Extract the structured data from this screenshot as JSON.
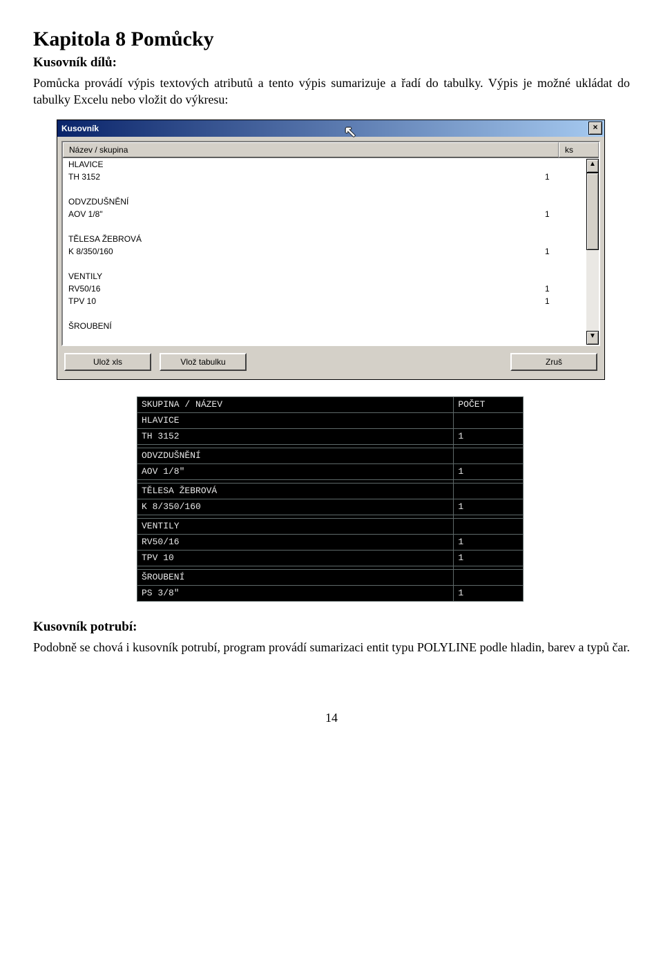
{
  "heading": "Kapitola 8   Pomůcky",
  "section1_title": "Kusovník dílů:",
  "section1_body": "Pomůcka provádí výpis textových atributů a tento výpis sumarizuje a řadí do tabulky. Výpis je možné ukládat do tabulky Excelu nebo vložit do výkresu:",
  "dialog": {
    "title": "Kusovník",
    "close": "×",
    "col_name": "Název / skupina",
    "col_ks": "ks",
    "rows": [
      {
        "name": "HLAVICE",
        "ks": ""
      },
      {
        "name": "TH 3152",
        "ks": "1"
      },
      {
        "name": "",
        "ks": ""
      },
      {
        "name": "ODVZDUŠNĚNÍ",
        "ks": ""
      },
      {
        "name": "AOV 1/8\"",
        "ks": "1"
      },
      {
        "name": "",
        "ks": ""
      },
      {
        "name": "TĚLESA ŽEBROVÁ",
        "ks": ""
      },
      {
        "name": "K 8/350/160",
        "ks": "1"
      },
      {
        "name": "",
        "ks": ""
      },
      {
        "name": "VENTILY",
        "ks": ""
      },
      {
        "name": "RV50/16",
        "ks": "1"
      },
      {
        "name": "TPV 10",
        "ks": "1"
      },
      {
        "name": "",
        "ks": ""
      },
      {
        "name": "ŠROUBENÍ",
        "ks": ""
      }
    ],
    "btn_save": "Ulož xls",
    "btn_insert": "Vlož tabulku",
    "btn_cancel": "Zruš"
  },
  "cad": {
    "hdr_name": "SKUPINA / NÁZEV",
    "hdr_count": "POČET",
    "rows": [
      {
        "name": "HLAVICE",
        "count": "",
        "blank_after": false
      },
      {
        "name": "TH 3152",
        "count": "1",
        "blank_after": true
      },
      {
        "name": "ODVZDUŠNĚNÍ",
        "count": "",
        "blank_after": false
      },
      {
        "name": "AOV 1/8\"",
        "count": "1",
        "blank_after": true
      },
      {
        "name": "TĚLESA ŽEBROVÁ",
        "count": "",
        "blank_after": false
      },
      {
        "name": "K 8/350/160",
        "count": "1",
        "blank_after": true
      },
      {
        "name": "VENTILY",
        "count": "",
        "blank_after": false
      },
      {
        "name": "RV50/16",
        "count": "1",
        "blank_after": false
      },
      {
        "name": "TPV 10",
        "count": "1",
        "blank_after": true
      },
      {
        "name": "ŠROUBENÍ",
        "count": "",
        "blank_after": false
      },
      {
        "name": "PS 3/8\"",
        "count": "1",
        "blank_after": false
      }
    ]
  },
  "section2_title": "Kusovník potrubí:",
  "section2_body": "Podobně se chová i kusovník potrubí, program provádí sumarizaci entit typu POLYLINE podle hladin, barev a typů čar.",
  "page_num": "14"
}
